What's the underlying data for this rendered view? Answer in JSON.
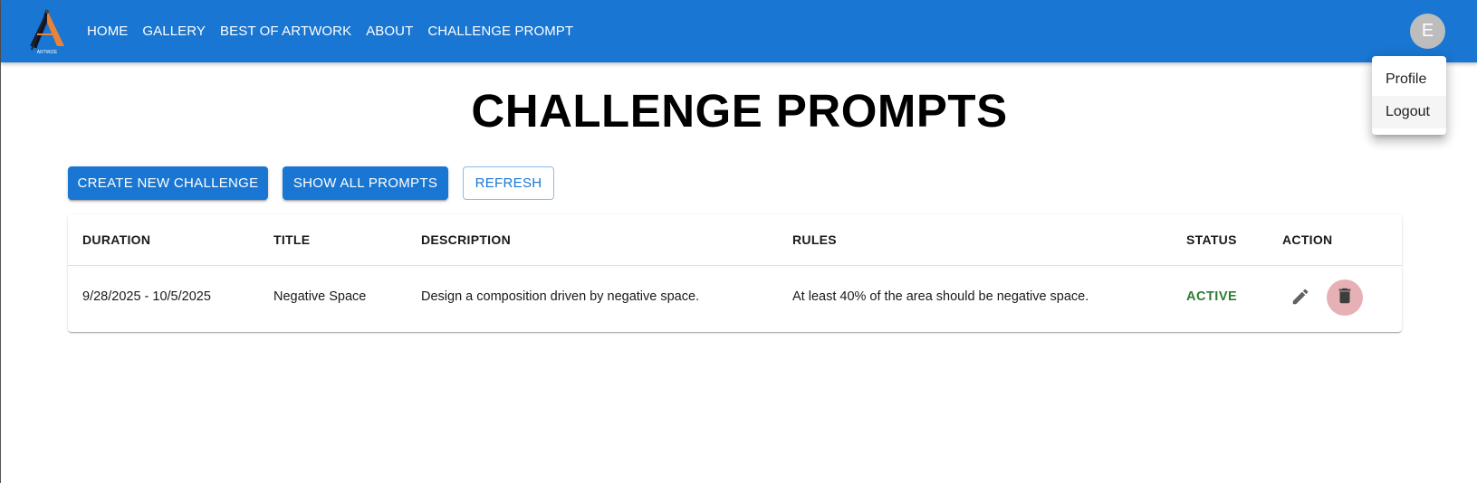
{
  "header": {
    "nav": [
      "HOME",
      "GALLERY",
      "BEST OF ARTWORK",
      "ABOUT",
      "CHALLENGE PROMPT"
    ],
    "logo_icon": "artwize-logo-icon",
    "logo_text": "ARTWIZE",
    "avatar_initial": "E",
    "bar_color": "#1976d2"
  },
  "user_menu": {
    "items": [
      "Profile",
      "Logout"
    ]
  },
  "page": {
    "title": "CHALLENGE PROMPTS"
  },
  "actions": {
    "create_label": "CREATE NEW CHALLENGE",
    "show_all_label": "SHOW ALL PROMPTS",
    "refresh_label": "REFRESH"
  },
  "table": {
    "columns": [
      "DURATION",
      "TITLE",
      "DESCRIPTION",
      "RULES",
      "STATUS",
      "ACTION"
    ],
    "rows": [
      {
        "duration": "9/28/2025 - 10/5/2025",
        "title": "Negative Space",
        "description": "Design a composition driven by negative space.",
        "rules": "At least 40% of the area should be negative space.",
        "status": "ACTIVE",
        "edit_icon": "pencil-icon",
        "delete_icon": "trash-icon"
      }
    ]
  },
  "colors": {
    "primary": "#1976d2",
    "status_active": "#2e7d32",
    "delete_bg": "#e6b1b4"
  }
}
